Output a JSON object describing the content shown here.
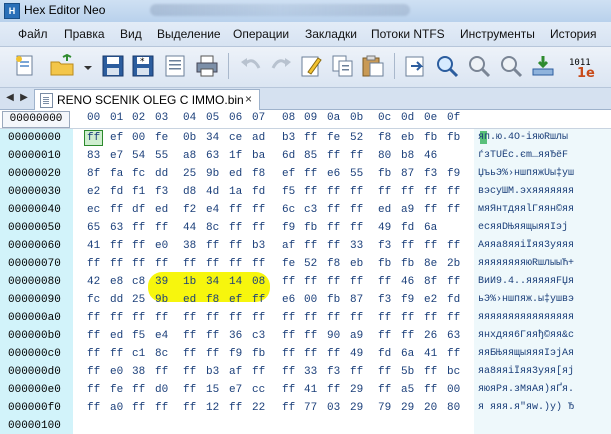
{
  "titlebar": {
    "title": "Hex Editor Neo"
  },
  "menu": [
    "Файл",
    "Правка",
    "Вид",
    "Выделение",
    "Операции",
    "Закладки",
    "Потоки NTFS",
    "Инструменты",
    "История"
  ],
  "toolbar_icons": [
    "new-file-icon",
    "open-folder-icon",
    "save-icon",
    "save-as-icon",
    "print-icon",
    "undo-icon",
    "redo-icon",
    "edit-icon",
    "copy-icon",
    "paste-icon",
    "export-icon",
    "find-icon",
    "find-next-icon",
    "find-replace-icon",
    "goto-icon",
    "data-inspector-icon"
  ],
  "tab": {
    "name": "RENO SCENIK OLEG C IMMO.bin"
  },
  "editor": {
    "offset_header": "00000000",
    "columns": [
      "00",
      "01",
      "02",
      "03",
      "04",
      "05",
      "06",
      "07",
      "08",
      "09",
      "0a",
      "0b",
      "0c",
      "0d",
      "0e",
      "0f"
    ],
    "rows": [
      {
        "addr": "00000000",
        "bytes": [
          "ff",
          "ef",
          "00",
          "fe",
          "0b",
          "34",
          "ce",
          "ad",
          "b3",
          "ff",
          "fe",
          "52",
          "f8",
          "eb",
          "fb",
          "fb"
        ],
        "text": "яп.ю.4О-іяюRшлы"
      },
      {
        "addr": "00000010",
        "bytes": [
          "83",
          "e7",
          "54",
          "55",
          "a8",
          "63",
          "1f",
          "ba",
          "6d",
          "85",
          "ff",
          "ff",
          "80",
          "b8",
          "46",
          ""
        ],
        "text": "ѓзTUЁc.єm…яяЂёF"
      },
      {
        "addr": "00000020",
        "bytes": [
          "8f",
          "fa",
          "fc",
          "dd",
          "25",
          "9b",
          "ed",
          "f8",
          "ef",
          "ff",
          "e6",
          "55",
          "fb",
          "87",
          "f3",
          "f9"
        ],
        "text": "ЏъьЭ%›ншпяжUы‡уш"
      },
      {
        "addr": "00000030",
        "bytes": [
          "e2",
          "fd",
          "f1",
          "f3",
          "d8",
          "4d",
          "1a",
          "fd",
          "f5",
          "ff",
          "ff",
          "ff",
          "ff",
          "ff",
          "ff",
          "ff"
        ],
        "text": "вэсуШМ.эхяяяяяяя"
      },
      {
        "addr": "00000040",
        "bytes": [
          "ec",
          "ff",
          "df",
          "ed",
          "f2",
          "e4",
          "ff",
          "ff",
          "6c",
          "c3",
          "ff",
          "ff",
          "ed",
          "a9",
          "ff",
          "ff"
        ],
        "text": "мяЯнтдяяlГяян©яя"
      },
      {
        "addr": "00000050",
        "bytes": [
          "65",
          "63",
          "ff",
          "ff",
          "44",
          "8c",
          "ff",
          "ff",
          "f9",
          "fb",
          "ff",
          "ff",
          "49",
          "fd",
          "6a",
          ""
        ],
        "text": "ecяяDЊяящыяяIэj"
      },
      {
        "addr": "00000060",
        "bytes": [
          "41",
          "ff",
          "ff",
          "e0",
          "38",
          "ff",
          "ff",
          "b3",
          "af",
          "ff",
          "ff",
          "33",
          "f3",
          "ff",
          "ff",
          "ff"
        ],
        "text": "Аяяа8яяіЇяя3уяяя"
      },
      {
        "addr": "00000070",
        "bytes": [
          "ff",
          "ff",
          "ff",
          "ff",
          "ff",
          "ff",
          "ff",
          "ff",
          "fe",
          "52",
          "f8",
          "eb",
          "fb",
          "fb",
          "8e",
          "2b"
        ],
        "text": "яяяяяяяяюRшлыыЋ+"
      },
      {
        "addr": "00000080",
        "bytes": [
          "42",
          "e8",
          "c8",
          "39",
          "1b",
          "34",
          "14",
          "08",
          "ff",
          "ff",
          "ff",
          "ff",
          "ff",
          "46",
          "8f",
          "ff"
        ],
        "text": "BиИ9.4..яяяяяFЏя"
      },
      {
        "addr": "00000090",
        "bytes": [
          "fc",
          "dd",
          "25",
          "9b",
          "ed",
          "f8",
          "ef",
          "ff",
          "e6",
          "00",
          "fb",
          "87",
          "f3",
          "f9",
          "e2",
          "fd"
        ],
        "text": "ьЭ%›ншпяж.ы‡ушвэ"
      },
      {
        "addr": "000000a0",
        "bytes": [
          "ff",
          "ff",
          "ff",
          "ff",
          "ff",
          "ff",
          "ff",
          "ff",
          "ff",
          "ff",
          "ff",
          "ff",
          "ff",
          "ff",
          "ff",
          "ff"
        ],
        "text": "яяяяяяяяяяяяяяяя"
      },
      {
        "addr": "000000b0",
        "bytes": [
          "ff",
          "ed",
          "f5",
          "e4",
          "ff",
          "ff",
          "36",
          "c3",
          "ff",
          "ff",
          "90",
          "a9",
          "ff",
          "ff",
          "26",
          "63"
        ],
        "text": "янхдяя6Гяяђ©яя&c"
      },
      {
        "addr": "000000c0",
        "bytes": [
          "ff",
          "ff",
          "c1",
          "8c",
          "ff",
          "ff",
          "f9",
          "fb",
          "ff",
          "ff",
          "ff",
          "49",
          "fd",
          "6a",
          "41",
          "ff"
        ],
        "text": "яяБЊяящыяяяIэjАя"
      },
      {
        "addr": "000000d0",
        "bytes": [
          "ff",
          "e0",
          "38",
          "ff",
          "ff",
          "b3",
          "af",
          "ff",
          "ff",
          "33",
          "f3",
          "ff",
          "ff",
          "5b",
          "ff",
          "bc"
        ],
        "text": "яа8яяіЇяя3уяя[яј"
      },
      {
        "addr": "000000e0",
        "bytes": [
          "ff",
          "fe",
          "ff",
          "d0",
          "ff",
          "15",
          "e7",
          "cc",
          "ff",
          "41",
          "ff",
          "29",
          "ff",
          "a5",
          "ff",
          "00"
        ],
        "text": "яюяРя.зМяАя)яҐя."
      },
      {
        "addr": "000000f0",
        "bytes": [
          "ff",
          "a0",
          "ff",
          "ff",
          "ff",
          "12",
          "ff",
          "22",
          "ff",
          "77",
          "03",
          "29",
          "79",
          "29",
          "20",
          "80"
        ],
        "text": "я яяя.я\"яw.)y) Ђ"
      },
      {
        "addr": "00000100",
        "bytes": [
          "",
          "",
          "",
          "",
          "",
          "",
          "",
          "",
          "",
          "",
          "",
          "",
          "",
          "",
          "",
          ""
        ],
        "text": ""
      }
    ]
  },
  "colors": {
    "highlight": "#f7f500",
    "address_bg": "#d2f3fa",
    "hex_text": "#1b3f7a",
    "cursor_border": "#2c8a2c"
  }
}
